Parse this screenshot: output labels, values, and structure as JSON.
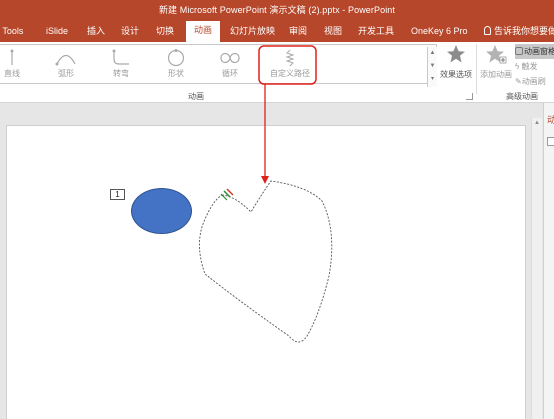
{
  "window": {
    "title": "新建 Microsoft PowerPoint 演示文稿 (2).pptx  -  PowerPoint"
  },
  "tabs": [
    {
      "label": "i Tools"
    },
    {
      "label": "iSlide"
    },
    {
      "label": "插入"
    },
    {
      "label": "设计"
    },
    {
      "label": "切换"
    },
    {
      "label": "动画",
      "active": true
    },
    {
      "label": "幻灯片放映"
    },
    {
      "label": "审阅"
    },
    {
      "label": "视图"
    },
    {
      "label": "开发工具"
    },
    {
      "label": "OneKey 6 Pro"
    }
  ],
  "tell_me": "告诉我你想要做什么",
  "animation_gallery": [
    {
      "label": "直线",
      "icon": "line-path-icon"
    },
    {
      "label": "弧形",
      "icon": "arc-path-icon"
    },
    {
      "label": "转弯",
      "icon": "turn-path-icon"
    },
    {
      "label": "形状",
      "icon": "shape-path-icon"
    },
    {
      "label": "循环",
      "icon": "loop-path-icon"
    },
    {
      "label": "自定义路径",
      "icon": "custom-path-icon",
      "highlighted": true
    }
  ],
  "ribbon": {
    "effect_options_label": "效果选项",
    "add_animation_label": "添加动画",
    "animation_pane_label": "动画窗格",
    "trigger_label": "触发",
    "animation_painter_label": "动画刷",
    "group_animation": "动画",
    "group_advanced": "高级动画"
  },
  "slide": {
    "animation_order": "1",
    "shape_color": "#4472c4"
  },
  "colors": {
    "accent": "#b7472a",
    "callout": "#e0201b"
  }
}
